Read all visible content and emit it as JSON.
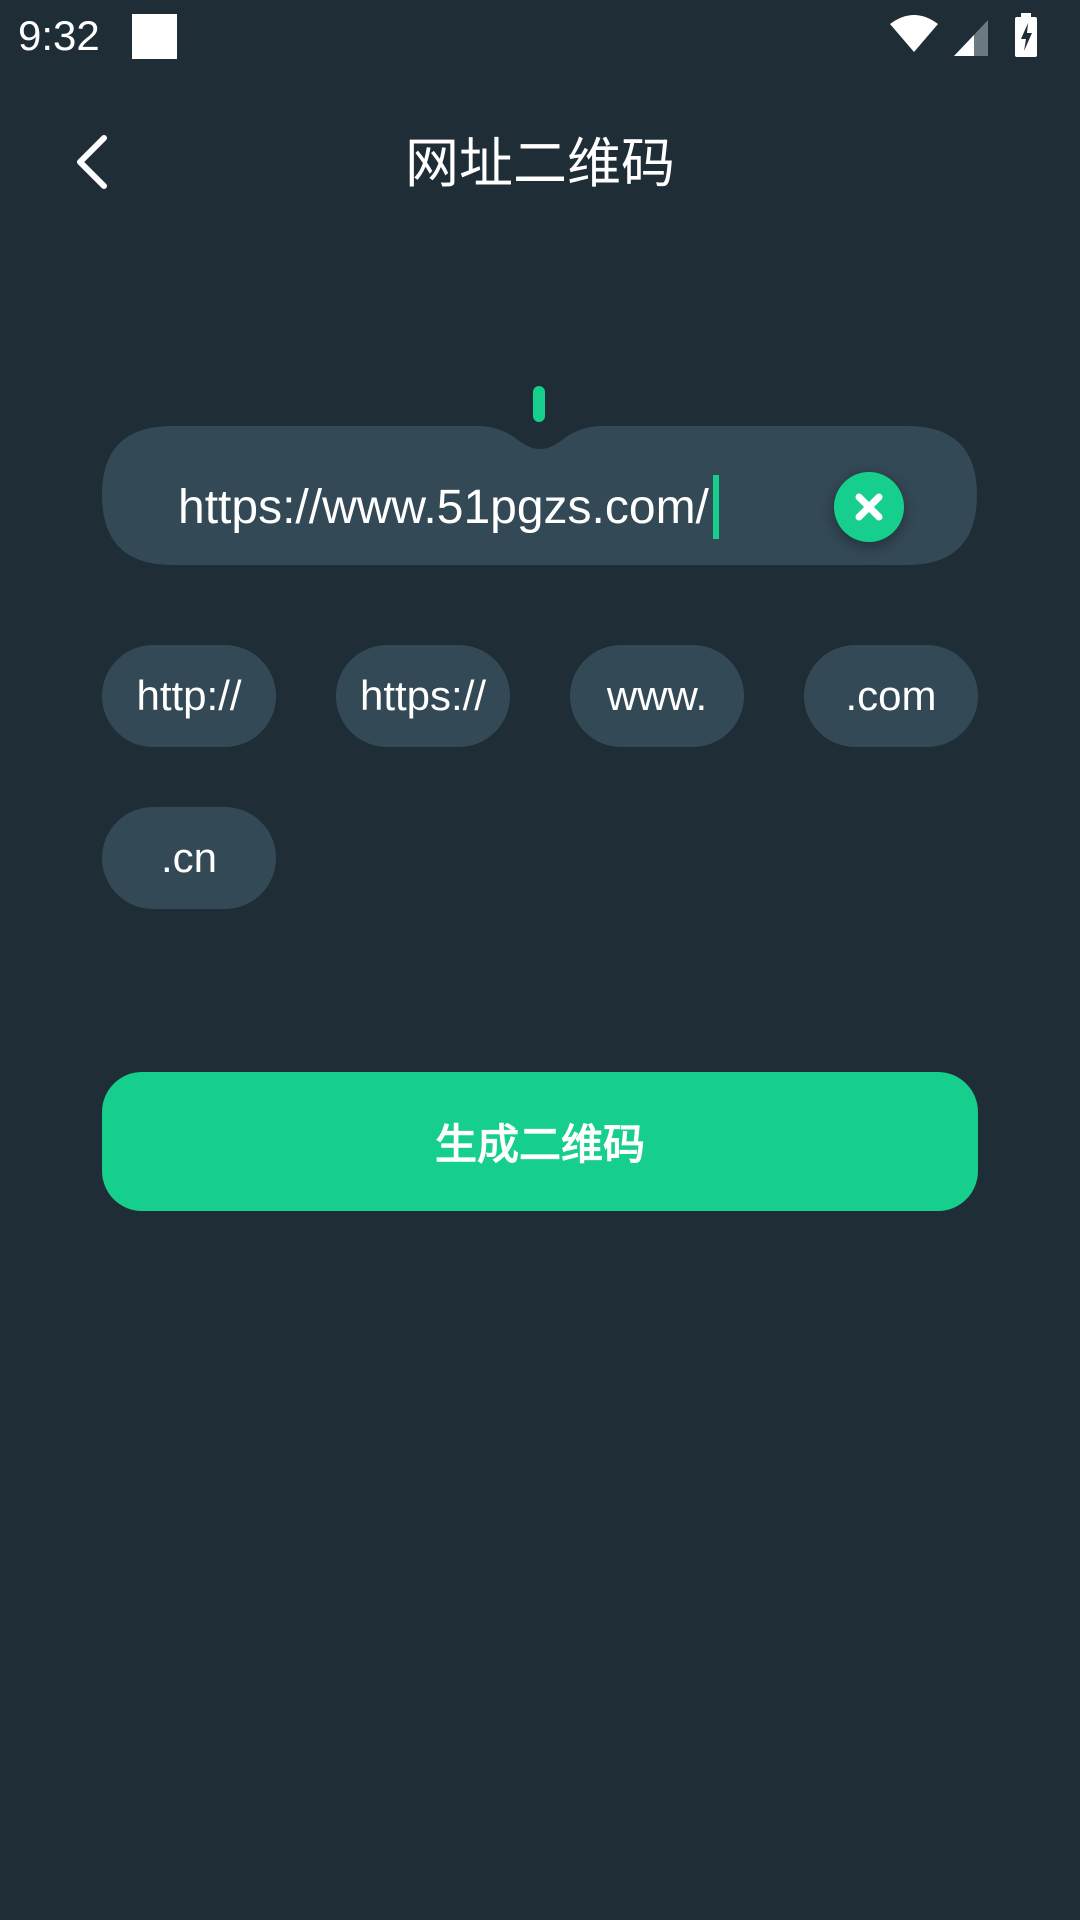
{
  "status_bar": {
    "time": "9:32",
    "icons": [
      "notification-square-icon",
      "wifi-icon",
      "cellular-signal-icon",
      "battery-charging-icon"
    ]
  },
  "header": {
    "title": "网址二维码",
    "back_icon": "chevron-left-icon"
  },
  "url_input": {
    "value": "https://www.51pgzs.com/",
    "clear_icon": "close-icon"
  },
  "chips": [
    {
      "label": "http://"
    },
    {
      "label": "https://"
    },
    {
      "label": "www."
    },
    {
      "label": ".com"
    },
    {
      "label": ".cn"
    }
  ],
  "generate_button": {
    "label": "生成二维码"
  },
  "colors": {
    "background": "#1f2d36",
    "surface": "#334955",
    "accent": "#17cf8d",
    "text": "#ffffff"
  }
}
